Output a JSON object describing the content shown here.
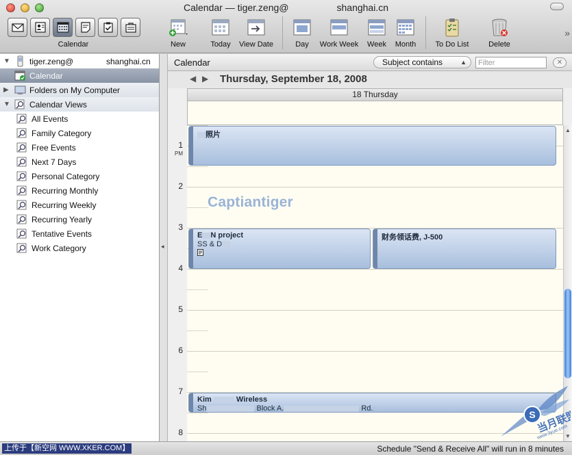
{
  "window": {
    "title": "Calendar — tiger.zeng@",
    "title_suffix": "shanghai.cn"
  },
  "toolbar": {
    "view_group_label": "Calendar",
    "view_buttons": [
      {
        "icon": "mail-icon"
      },
      {
        "icon": "address-book-icon"
      },
      {
        "icon": "calendar-icon",
        "active": true
      },
      {
        "icon": "notes-icon"
      },
      {
        "icon": "tasks-icon"
      },
      {
        "icon": "project-gallery-icon"
      }
    ],
    "new_label": "New",
    "today_label": "Today",
    "view_date_label": "View Date",
    "day_label": "Day",
    "work_week_label": "Work Week",
    "week_label": "Week",
    "month_label": "Month",
    "todo_label": "To Do List",
    "delete_label": "Delete",
    "overflow": "»"
  },
  "sidebar": {
    "account": {
      "name": "tiger.zeng@",
      "domain": "shanghai.cn"
    },
    "calendar_label": "Calendar",
    "folders_label": "Folders on My Computer",
    "views_label": "Calendar Views",
    "views": [
      "All Events",
      "Family Category",
      "Free Events",
      "Next 7 Days",
      "Personal Category",
      "Recurring Monthly",
      "Recurring Weekly",
      "Recurring Yearly",
      "Tentative Events",
      "Work Category"
    ]
  },
  "main": {
    "header_title": "Calendar",
    "search_field_label": "Subject contains",
    "filter_placeholder": "Filter",
    "date_title": "Thursday, September 18, 2008",
    "day_column_header": "18 Thursday",
    "hours": [
      "1",
      "2",
      "3",
      "4",
      "5",
      "6",
      "7",
      "8"
    ],
    "pm_label": "PM",
    "watermark_text": "Captiantiger",
    "events": [
      {
        "title": "照片",
        "subtitle": ""
      },
      {
        "title": "E",
        "title_tail": "N project",
        "subtitle": "SS & D"
      },
      {
        "title": "财务领话费, J-500",
        "subtitle": ""
      },
      {
        "title": "Kim",
        "title_tail": "Wireless",
        "subtitle": "Sh",
        "subtitle_mid": "Block A.",
        "subtitle_tail": "Rd."
      }
    ]
  },
  "statusbar": {
    "left_text": "上传于【新空网 WWW.XKER.COM】",
    "right_text": "Schedule \"Send & Receive All\" will run in 8 minutes"
  },
  "watermark_logo": {
    "text": "当月联盟",
    "url_text": "www.3yue.com"
  },
  "colors": {
    "event_fill": "#a8bfdd",
    "selected_row": "#8893a5",
    "scroll_thumb": "#3d7fd6",
    "day_background": "#fffdf2"
  }
}
